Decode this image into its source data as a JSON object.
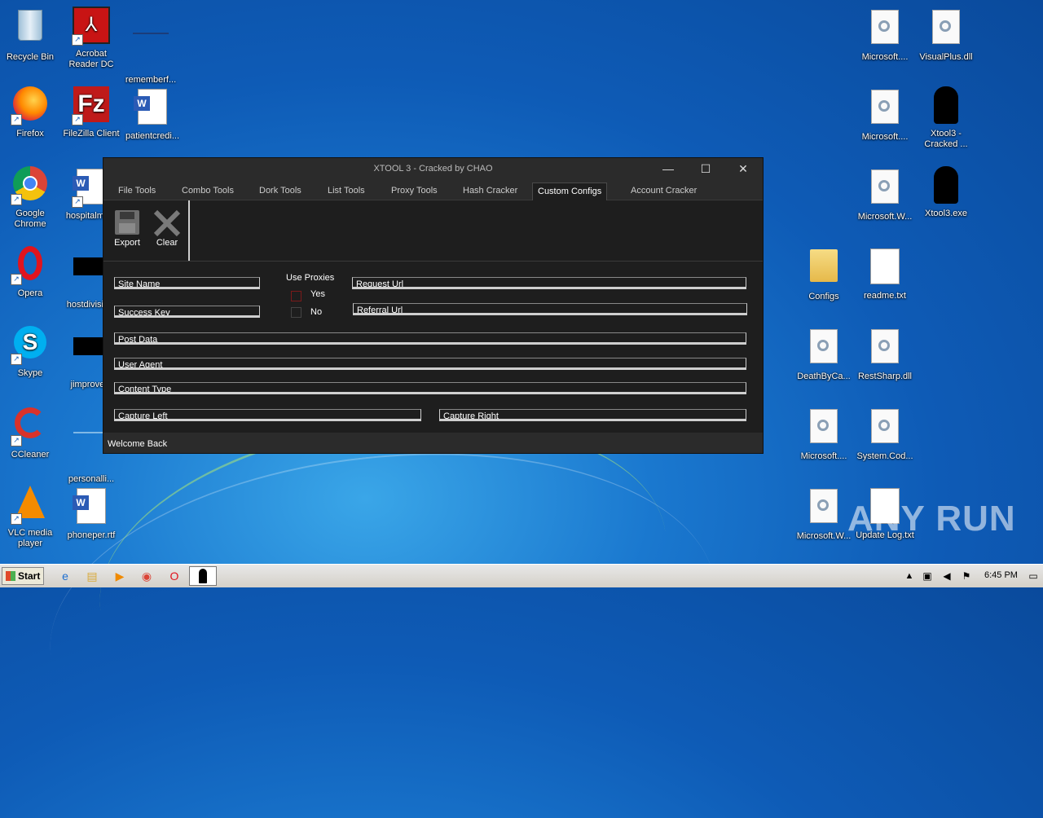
{
  "desktop": {
    "icons_left": [
      {
        "label": "Recycle Bin",
        "icon": "recycle-bin-icon"
      },
      {
        "label": "Acrobat Reader DC",
        "icon": "acrobat-icon"
      },
      {
        "label": "rememberf...",
        "icon": "file-icon"
      },
      {
        "label": "Firefox",
        "icon": "firefox-icon"
      },
      {
        "label": "FileZilla Client",
        "icon": "filezilla-icon"
      },
      {
        "label": "patientcredi...",
        "icon": "word-doc-icon"
      },
      {
        "label": "Google Chrome",
        "icon": "chrome-icon"
      },
      {
        "label": "hospitalme...",
        "icon": "word-doc-icon"
      },
      {
        "label": "Opera",
        "icon": "opera-icon"
      },
      {
        "label": "hostdivisio...",
        "icon": "file-icon"
      },
      {
        "label": "Skype",
        "icon": "skype-icon"
      },
      {
        "label": "jimprove...",
        "icon": "file-icon"
      },
      {
        "label": "CCleaner",
        "icon": "ccleaner-icon"
      },
      {
        "label": "personalli...",
        "icon": "file-icon"
      },
      {
        "label": "VLC media player",
        "icon": "vlc-icon"
      },
      {
        "label": "phoneper.rtf",
        "icon": "word-doc-icon"
      }
    ],
    "icons_right": [
      {
        "label": "Microsoft....",
        "icon": "dll-icon"
      },
      {
        "label": "VisualPlus.dll",
        "icon": "dll-icon"
      },
      {
        "label": "Microsoft....",
        "icon": "dll-icon"
      },
      {
        "label": "Xtool3 - Cracked ...",
        "icon": "reaper-icon"
      },
      {
        "label": "Microsoft.W...",
        "icon": "dll-icon"
      },
      {
        "label": "Xtool3.exe",
        "icon": "reaper-icon"
      },
      {
        "label": "Configs",
        "icon": "folder-icon"
      },
      {
        "label": "readme.txt",
        "icon": "text-file-icon"
      },
      {
        "label": "DeathByCa...",
        "icon": "dll-icon"
      },
      {
        "label": "RestSharp.dll",
        "icon": "dll-icon"
      },
      {
        "label": "Microsoft....",
        "icon": "dll-icon"
      },
      {
        "label": "System.Cod...",
        "icon": "dll-icon"
      },
      {
        "label": "Microsoft.W...",
        "icon": "dll-icon"
      },
      {
        "label": "Update Log.txt",
        "icon": "text-file-icon"
      }
    ],
    "watermark": "ANY RUN"
  },
  "window": {
    "title": "XTOOL 3 - Cracked by CHAO",
    "controls": {
      "minimize": "—",
      "maximize": "☐",
      "close": "✕"
    },
    "tabs": [
      {
        "label": "File Tools"
      },
      {
        "label": "Combo Tools"
      },
      {
        "label": "Dork Tools"
      },
      {
        "label": "List Tools"
      },
      {
        "label": "Proxy Tools"
      },
      {
        "label": "Hash Cracker"
      },
      {
        "label": "Custom Configs",
        "active": true
      },
      {
        "label": "Account Cracker"
      }
    ],
    "toolbar": {
      "export_label": "Export",
      "clear_label": "Clear"
    },
    "form": {
      "site_name": "Site Name",
      "success_key": "Success Key",
      "use_proxies_label": "Use Proxies",
      "yes_label": "Yes",
      "no_label": "No",
      "request_url": "Request Url",
      "referral_url": "Referral Url",
      "post_data": "Post Data",
      "user_agent": "User Agent",
      "content_type": "Content Type",
      "capture_left": "Capture Left",
      "capture_right": "Capture Right"
    },
    "status": "Welcome Back"
  },
  "taskbar": {
    "start_label": "Start",
    "clock": "6:45 PM",
    "pinned": [
      "ie-icon",
      "explorer-icon",
      "media-player-icon",
      "chrome-icon",
      "opera-icon",
      "xtool-icon"
    ]
  }
}
